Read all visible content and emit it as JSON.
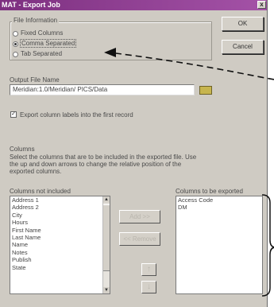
{
  "window": {
    "title": "MAT - Export Job",
    "close_glyph": "x"
  },
  "file_information": {
    "group_label": "File Information",
    "options": [
      {
        "label": "Fixed Columns",
        "selected": false
      },
      {
        "label": "Comma Separated",
        "selected": true
      },
      {
        "label": "Tab Separated",
        "selected": false
      }
    ]
  },
  "buttons": {
    "ok": "OK",
    "cancel": "Cancel"
  },
  "output": {
    "label": "Output File Name",
    "value": "Meridian:1.0/Meridian/ PICS/Data",
    "export_labels_checkbox": {
      "label": "Export column labels into the first record",
      "checked": true
    }
  },
  "columns": {
    "group_label": "Columns",
    "description": [
      "Select the columns that are to be included in the exported file.  Use",
      "the up and down arrows to change the relative position of the",
      "exported columns."
    ],
    "not_included_label": "Columns not included",
    "not_included": [
      "Address 1",
      "Address 2",
      "City",
      "Hours",
      "First Name",
      "Last Name",
      "Name",
      "Notes",
      "Publish",
      "State"
    ],
    "to_export_label": "Columns to be exported",
    "to_export": [
      "Access Code",
      "DM"
    ],
    "add_label": "Add >>",
    "remove_label": "<< Remove",
    "up_glyph": "↑",
    "down_glyph": "↓"
  }
}
